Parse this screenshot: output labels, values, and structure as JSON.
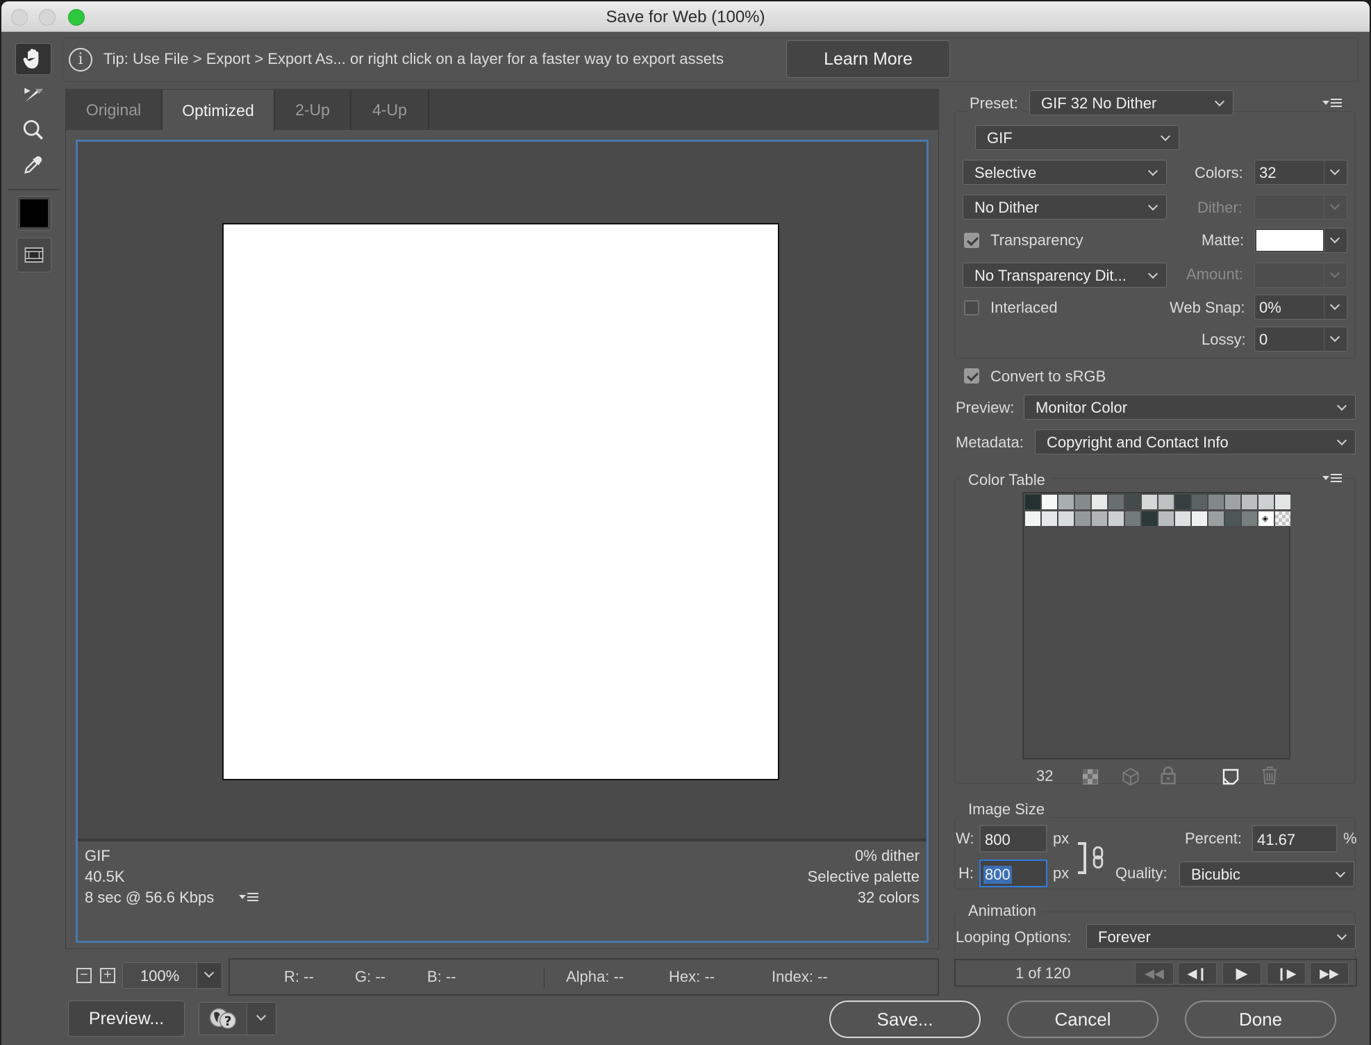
{
  "window": {
    "title": "Save for Web (100%)"
  },
  "tools": [
    {
      "name": "hand-tool",
      "active": true
    },
    {
      "name": "slice-select-tool",
      "active": false
    },
    {
      "name": "zoom-tool",
      "active": false
    },
    {
      "name": "eyedropper-tool",
      "active": false
    }
  ],
  "eyedropper_color": "#000000",
  "tip": {
    "text": "Tip: Use File > Export > Export As...  or right click on a layer for a faster way to export assets",
    "learn_more": "Learn More"
  },
  "view_tabs": [
    {
      "label": "Original",
      "active": false
    },
    {
      "label": "Optimized",
      "active": true
    },
    {
      "label": "2-Up",
      "active": false
    },
    {
      "label": "4-Up",
      "active": false
    }
  ],
  "canvas_info": {
    "format": "GIF",
    "size": "40.5K",
    "download_time": "8 sec @ 56.6 Kbps",
    "dither": "0% dither",
    "palette": "Selective palette",
    "colors": "32 colors"
  },
  "zoom": {
    "value": "100%",
    "zoom_out": "−",
    "zoom_in": "+"
  },
  "readout": {
    "r": "R: --",
    "g": "G: --",
    "b": "B: --",
    "alpha": "Alpha: --",
    "hex": "Hex: --",
    "index": "Index: --"
  },
  "bottom_buttons": {
    "preview": "Preview...",
    "save": "Save...",
    "cancel": "Cancel",
    "done": "Done"
  },
  "settings": {
    "preset_label": "Preset:",
    "preset": "GIF 32 No Dither",
    "format": "GIF",
    "reduction": "Selective",
    "dither_algorithm": "No Dither",
    "colors_label": "Colors:",
    "colors": "32",
    "dither_label": "Dither:",
    "dither": "",
    "transparency_label": "Transparency",
    "transparency": true,
    "matte_label": "Matte:",
    "matte_color": "#ffffff",
    "transparency_dither": "No Transparency Dit...",
    "amount_label": "Amount:",
    "amount": "",
    "interlaced_label": "Interlaced",
    "interlaced": false,
    "web_snap_label": "Web Snap:",
    "web_snap": "0%",
    "lossy_label": "Lossy:",
    "lossy": "0",
    "convert_srgb_label": "Convert to sRGB",
    "convert_srgb": true,
    "preview_label": "Preview:",
    "preview": "Monitor Color",
    "metadata_label": "Metadata:",
    "metadata": "Copyright and Contact Info"
  },
  "color_table": {
    "title": "Color Table",
    "count": "32",
    "colors": [
      "#243130",
      "#f6f8f7",
      "#a9aeae",
      "#858b8b",
      "#e8e9e9",
      "#686f6e",
      "#434b4b",
      "#d6d8d8",
      "#bec1c1",
      "#363f3f",
      "#5a6262",
      "#828888",
      "#9ea3a3",
      "#bbbfbf",
      "#cdd0d0",
      "#e3e4e4",
      "#f2f3f3",
      "#e6e7e8",
      "#d9dcdd",
      "#939a99",
      "#b1b5b5",
      "#ccd0d1",
      "#737b7a",
      "#2b3939",
      "#b8bcbc",
      "#dfe0e1",
      "#eff0f0",
      "#9aa0a0",
      "#4d5757",
      "#78807f",
      "#ffffff",
      "transparent"
    ]
  },
  "image_size": {
    "title": "Image Size",
    "w_label": "W:",
    "width": "800",
    "h_label": "H:",
    "height": "800",
    "unit": "px",
    "percent_label": "Percent:",
    "percent": "41.67",
    "percent_unit": "%",
    "quality_label": "Quality:",
    "quality": "Bicubic"
  },
  "animation": {
    "title": "Animation",
    "looping_label": "Looping Options:",
    "looping": "Forever",
    "frame": "1 of 120"
  }
}
